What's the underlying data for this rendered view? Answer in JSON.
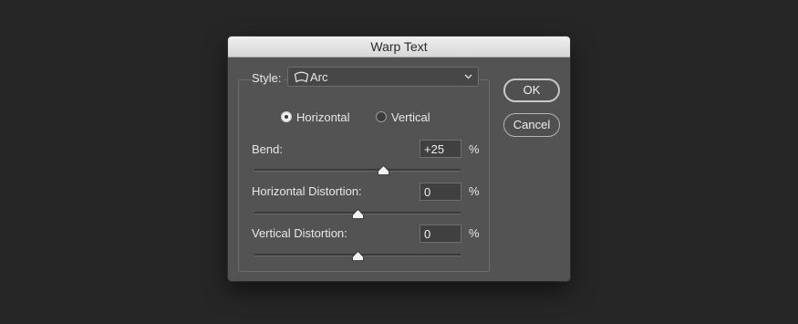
{
  "dialog": {
    "title": "Warp Text"
  },
  "style": {
    "label": "Style:",
    "value": "Arc",
    "icon": "arc-icon"
  },
  "orientation": {
    "horizontal_label": "Horizontal",
    "vertical_label": "Vertical",
    "selected": "Horizontal"
  },
  "bend": {
    "label": "Bend:",
    "value": "+25",
    "unit": "%",
    "slider_percent": 62.5
  },
  "horizontal_distortion": {
    "label": "Horizontal Distortion:",
    "value": "0",
    "unit": "%",
    "slider_percent": 50
  },
  "vertical_distortion": {
    "label": "Vertical Distortion:",
    "value": "0",
    "unit": "%",
    "slider_percent": 50
  },
  "buttons": {
    "ok": "OK",
    "cancel": "Cancel"
  },
  "colors": {
    "backdrop": "#262626",
    "dialog": "#535353",
    "titlebar": "#dcdcdc"
  }
}
